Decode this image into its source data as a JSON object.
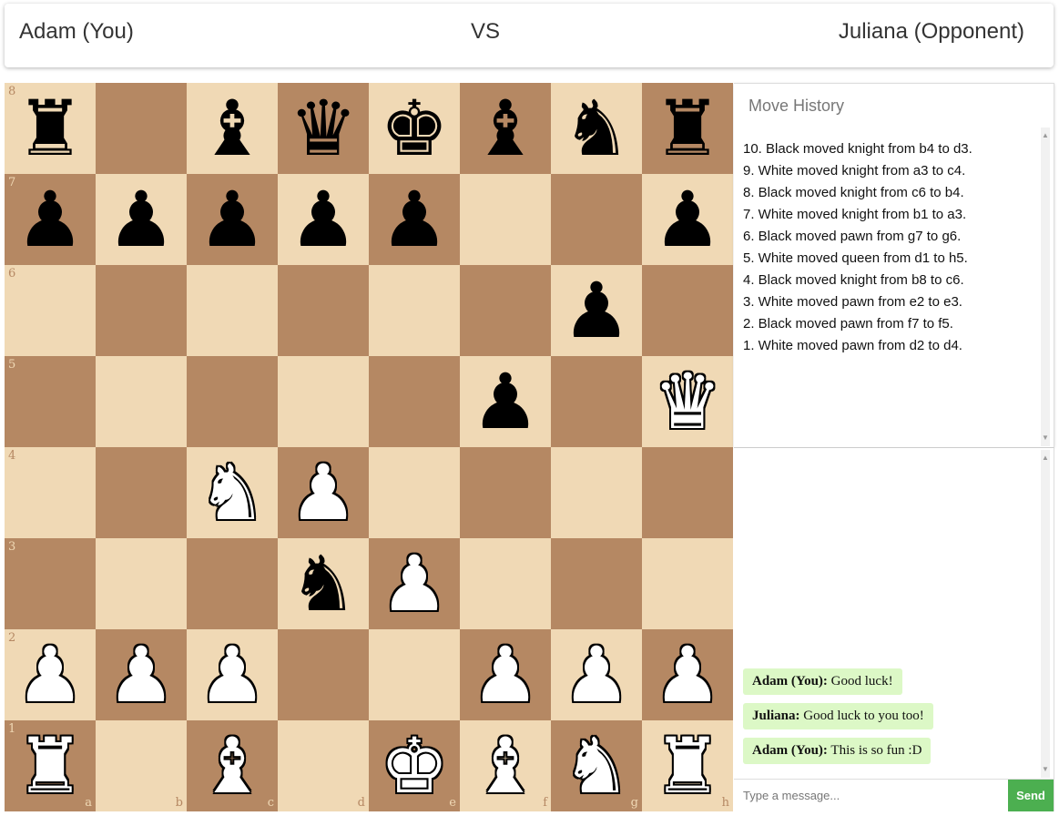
{
  "header": {
    "player_left": "Adam (You)",
    "vs": "VS",
    "player_right": "Juliana (Opponent)"
  },
  "board": {
    "light_color": "#f0d9b5",
    "dark_color": "#b58863",
    "files": [
      "a",
      "b",
      "c",
      "d",
      "e",
      "f",
      "g",
      "h"
    ],
    "ranks": [
      "8",
      "7",
      "6",
      "5",
      "4",
      "3",
      "2",
      "1"
    ],
    "position": [
      [
        "bR",
        null,
        "bB",
        "bQ",
        "bK",
        "bB",
        "bN",
        "bR"
      ],
      [
        "bP",
        "bP",
        "bP",
        "bP",
        "bP",
        null,
        null,
        "bP"
      ],
      [
        null,
        null,
        null,
        null,
        null,
        null,
        "bP",
        null
      ],
      [
        null,
        null,
        null,
        null,
        null,
        "bP",
        null,
        "wQ"
      ],
      [
        null,
        null,
        "wN",
        "wP",
        null,
        null,
        null,
        null
      ],
      [
        null,
        null,
        null,
        "bN",
        "wP",
        null,
        null,
        null
      ],
      [
        "wP",
        "wP",
        "wP",
        null,
        null,
        "wP",
        "wP",
        "wP"
      ],
      [
        "wR",
        null,
        "wB",
        null,
        "wK",
        "wB",
        "wN",
        "wR"
      ]
    ],
    "piece_glyphs": {
      "K": "♚",
      "Q": "♛",
      "R": "♜",
      "B": "♝",
      "N": "♞",
      "P": "♟"
    }
  },
  "move_history": {
    "title": "Move History",
    "moves": [
      "10. Black moved knight from b4 to d3.",
      "9. White moved knight from a3 to c4.",
      "8. Black moved knight from c6 to b4.",
      "7. White moved knight from b1 to a3.",
      "6. Black moved pawn from g7 to g6.",
      "5. White moved queen from d1 to h5.",
      "4. Black moved knight from b8 to c6.",
      "3. White moved pawn from e2 to e3.",
      "2. Black moved pawn from f7 to f5.",
      "1. White moved pawn from d2 to d4."
    ]
  },
  "chat": {
    "messages": [
      {
        "sender": "Adam (You):",
        "text": "Good luck!"
      },
      {
        "sender": "Juliana:",
        "text": "Good luck to you too!"
      },
      {
        "sender": "Adam (You):",
        "text": "This is so fun :D"
      }
    ],
    "input_placeholder": "Type a message...",
    "send_label": "Send",
    "message_bg": "#dcf8c6",
    "send_color": "#4caf50"
  }
}
